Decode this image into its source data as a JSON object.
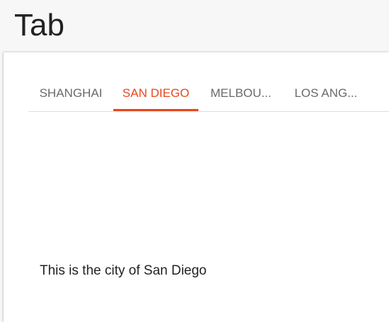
{
  "header": {
    "title": "Tab"
  },
  "tabs": {
    "items": [
      {
        "label": "SHANGHAI",
        "active": false
      },
      {
        "label": "SAN DIEGO",
        "active": true
      },
      {
        "label": "MELBOU...",
        "active": false
      },
      {
        "label": "LOS ANG...",
        "active": false
      }
    ],
    "active_index": 1
  },
  "content": {
    "text": "This is the city of San Diego"
  },
  "colors": {
    "accent": "#e8471b",
    "tab_inactive": "#6a6a6a",
    "text": "#222222"
  }
}
